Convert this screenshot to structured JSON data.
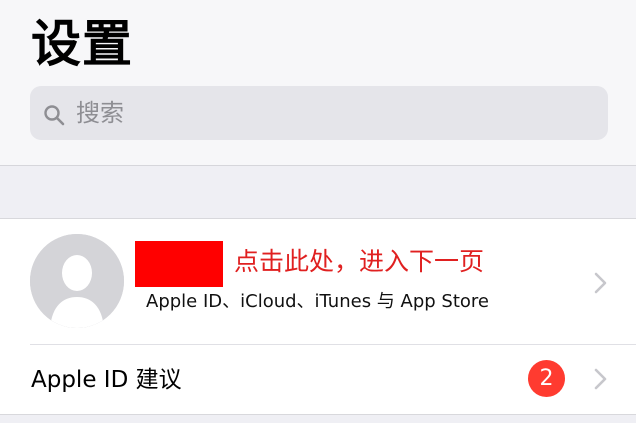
{
  "header": {
    "title": "设置"
  },
  "search": {
    "placeholder": "搜索"
  },
  "account": {
    "annotation": "点击此处，进入下一页",
    "subtitle": "Apple ID、iCloud、iTunes 与 App Store",
    "avatar_icon": "person-silhouette-icon",
    "redaction_color": "#ff0000"
  },
  "suggestions": {
    "label": "Apple ID 建议",
    "badge_count": "2",
    "badge_color": "#ff3b30"
  },
  "icons": {
    "search": "search-icon",
    "chevron": "chevron-right-icon"
  }
}
